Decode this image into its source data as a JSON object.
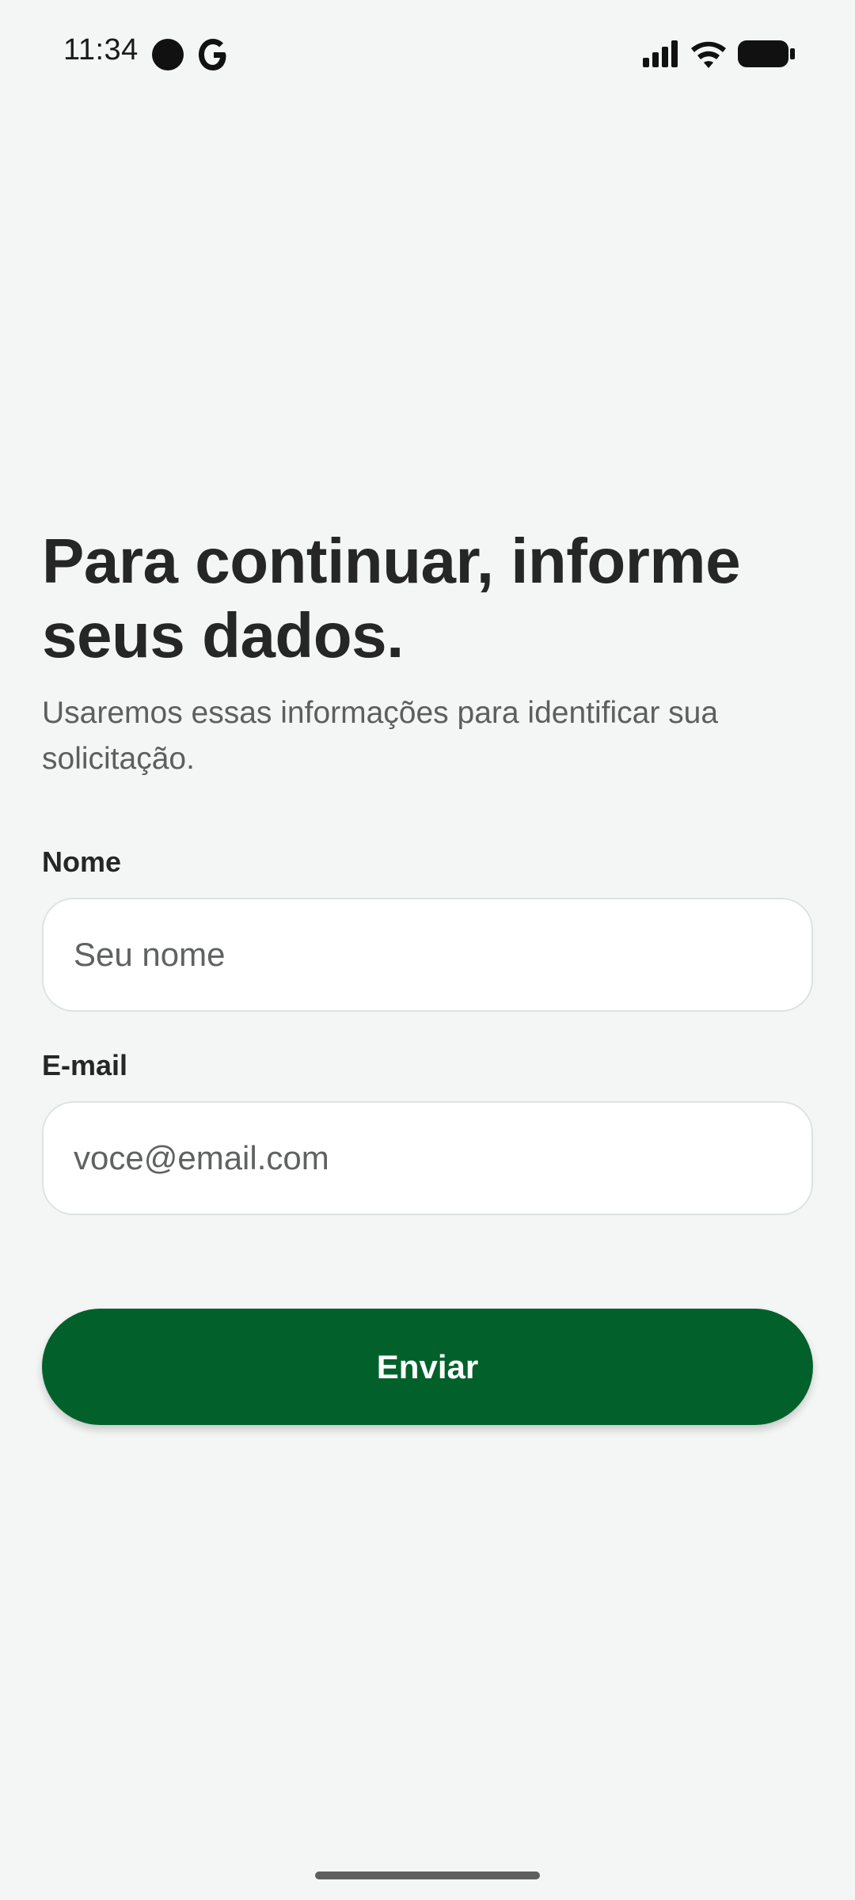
{
  "status_bar": {
    "time": "11:34",
    "icons": [
      "notification-dot-icon",
      "google-icon",
      "signal-icon",
      "wifi-icon",
      "battery-icon"
    ]
  },
  "form": {
    "title": "Para continuar, informe seus dados.",
    "subtitle": "Usaremos essas informações para identificar sua solicitação.",
    "name_label": "Nome",
    "name_placeholder": "Seu nome",
    "email_label": "E-mail",
    "email_placeholder": "voce@email.com",
    "submit_label": "Enviar"
  },
  "colors": {
    "background": "#f4f6f5",
    "primary": "#02612b",
    "text": "#262626",
    "muted": "#5c5f5e"
  }
}
